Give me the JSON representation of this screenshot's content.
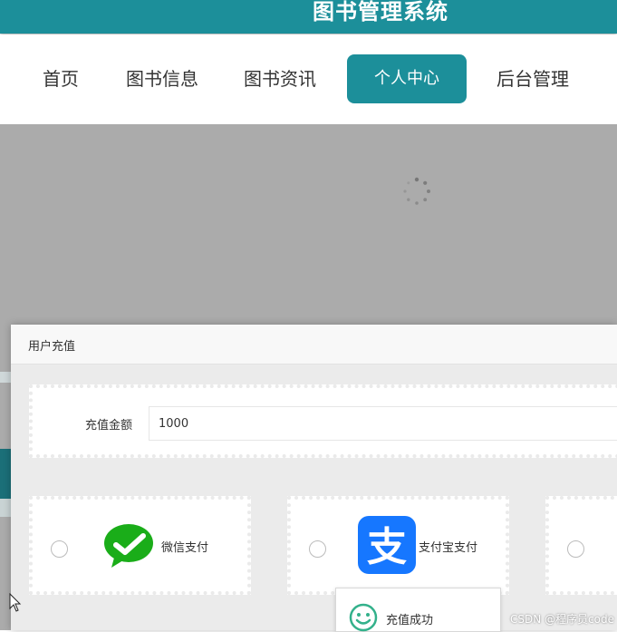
{
  "header": {
    "title": "图书管理系统"
  },
  "nav": {
    "items": [
      {
        "label": "首页"
      },
      {
        "label": "图书信息"
      },
      {
        "label": "图书资讯"
      },
      {
        "label": "个人中心"
      },
      {
        "label": "后台管理"
      }
    ],
    "active_index": 3
  },
  "dialog": {
    "title": "用户充值",
    "amount_label": "充值金额",
    "amount_value": "1000",
    "payment_options": [
      {
        "label": "微信支付",
        "icon": "wechat-pay-icon",
        "selected": false
      },
      {
        "label": "支付宝支付",
        "icon": "alipay-icon",
        "selected": false
      },
      {
        "label": "",
        "selected": false
      }
    ]
  },
  "toast": {
    "message": "充值成功",
    "icon": "smile-icon"
  },
  "watermark": "CSDN @程序员code",
  "colors": {
    "primary": "#1c8f9a",
    "wechat_green": "#1aad19",
    "alipay_blue": "#1677ff",
    "success_green": "#33b18b",
    "overlay_gray": "#ababab"
  }
}
